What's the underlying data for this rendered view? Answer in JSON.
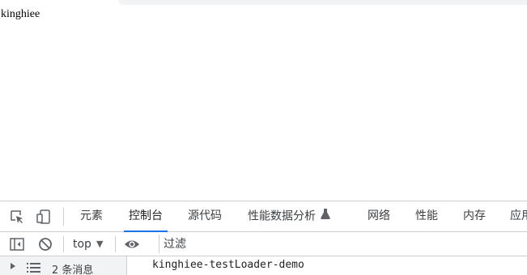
{
  "page": {
    "body_text": "kinghiee"
  },
  "devtools": {
    "tabs": [
      {
        "label": "元素"
      },
      {
        "label": "控制台",
        "active": true
      },
      {
        "label": "源代码"
      },
      {
        "label": "性能数据分析"
      },
      {
        "label": "网络"
      },
      {
        "label": "性能"
      },
      {
        "label": "内存"
      },
      {
        "label": "应用"
      }
    ],
    "icons": {
      "inspect": "inspect-element-icon",
      "device": "device-toggle-icon",
      "experimental": "flask-icon"
    },
    "console_toolbar": {
      "context": "top",
      "filter_placeholder": "过滤",
      "icons": [
        "sidebar-toggle-icon",
        "clear-console-icon",
        "eye-icon"
      ]
    },
    "sidebar": {
      "messages_label": "2 条消息"
    },
    "console_output": [
      "kinghiee-testLoader-demo"
    ]
  },
  "colors": {
    "accent": "#1a73e8",
    "border": "#cbcdd1",
    "text": "#3c4043"
  }
}
